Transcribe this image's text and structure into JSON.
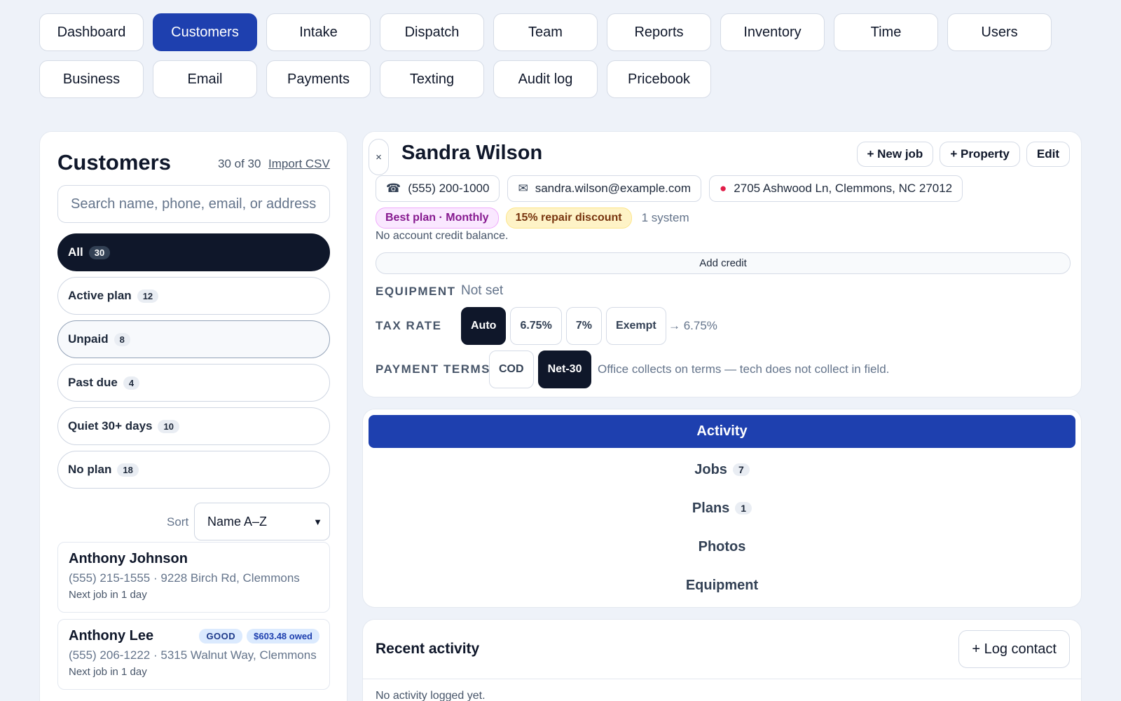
{
  "nav": [
    "Dashboard",
    "Customers",
    "Intake",
    "Dispatch",
    "Team",
    "Reports",
    "Inventory",
    "Time",
    "Users",
    "Business",
    "Email",
    "Payments",
    "Texting",
    "Audit log",
    "Pricebook"
  ],
  "list": {
    "title": "Customers",
    "count": "30 of 30",
    "import_label": "Import CSV",
    "search_placeholder": "Search name, phone, email, or address",
    "filters": [
      {
        "label": "All",
        "count": "30"
      },
      {
        "label": "Active plan",
        "count": "12"
      },
      {
        "label": "Unpaid",
        "count": "8"
      },
      {
        "label": "Past due",
        "count": "4"
      },
      {
        "label": "Quiet 30+ days",
        "count": "10"
      },
      {
        "label": "No plan",
        "count": "18"
      }
    ],
    "sort_label": "Sort",
    "sort_value": "Name A–Z",
    "customers": [
      {
        "name": "Anthony Johnson",
        "meta": "(555) 215-1555 · 9228 Birch Rd, Clemmons",
        "next": "Next job in 1 day"
      },
      {
        "name": "Anthony Lee",
        "meta": "(555) 206-1222 · 5315 Walnut Way, Clemmons",
        "next": "Next job in 1 day",
        "status": "GOOD",
        "owed": "$603.48 owed"
      }
    ]
  },
  "detail": {
    "close": "×",
    "name": "Sandra Wilson",
    "actions": [
      "+ New job",
      "+ Property",
      "Edit"
    ],
    "phone": "(555) 200-1000",
    "email": "sandra.wilson@example.com",
    "address": "2705 Ashwood Ln, Clemmons, NC 27012",
    "plan_pill": "Best plan · Monthly",
    "discount_pill": "15% repair discount",
    "systems": "1 system",
    "credit_text": "No account credit balance.",
    "add_credit": "Add credit",
    "equipment_label": "EQUIPMENT",
    "equipment_value": "Not set",
    "tax_label": "TAX RATE",
    "tax_options": [
      "Auto",
      "6.75%",
      "7%",
      "Exempt"
    ],
    "tax_result": "→ 6.75%",
    "terms_label": "PAYMENT TERMS",
    "terms_options": [
      "COD",
      "Net-30"
    ],
    "terms_hint": "Office collects on terms — tech does not collect in field."
  },
  "tabs": [
    {
      "label": "Activity"
    },
    {
      "label": "Jobs",
      "count": "7"
    },
    {
      "label": "Plans",
      "count": "1"
    },
    {
      "label": "Photos"
    },
    {
      "label": "Equipment"
    }
  ],
  "recent": {
    "title": "Recent activity",
    "log_button": "+ Log contact",
    "empty": "No activity logged yet."
  },
  "icons": {
    "phone": "phone-icon",
    "email": "mail-icon",
    "address": "map-pin-icon",
    "close": "close-icon",
    "sort": "chevron-down-icon"
  },
  "colors": {
    "accent": "#1e40af",
    "dark": "#0f172a",
    "plan": "#86198f",
    "discount": "#78350f"
  }
}
